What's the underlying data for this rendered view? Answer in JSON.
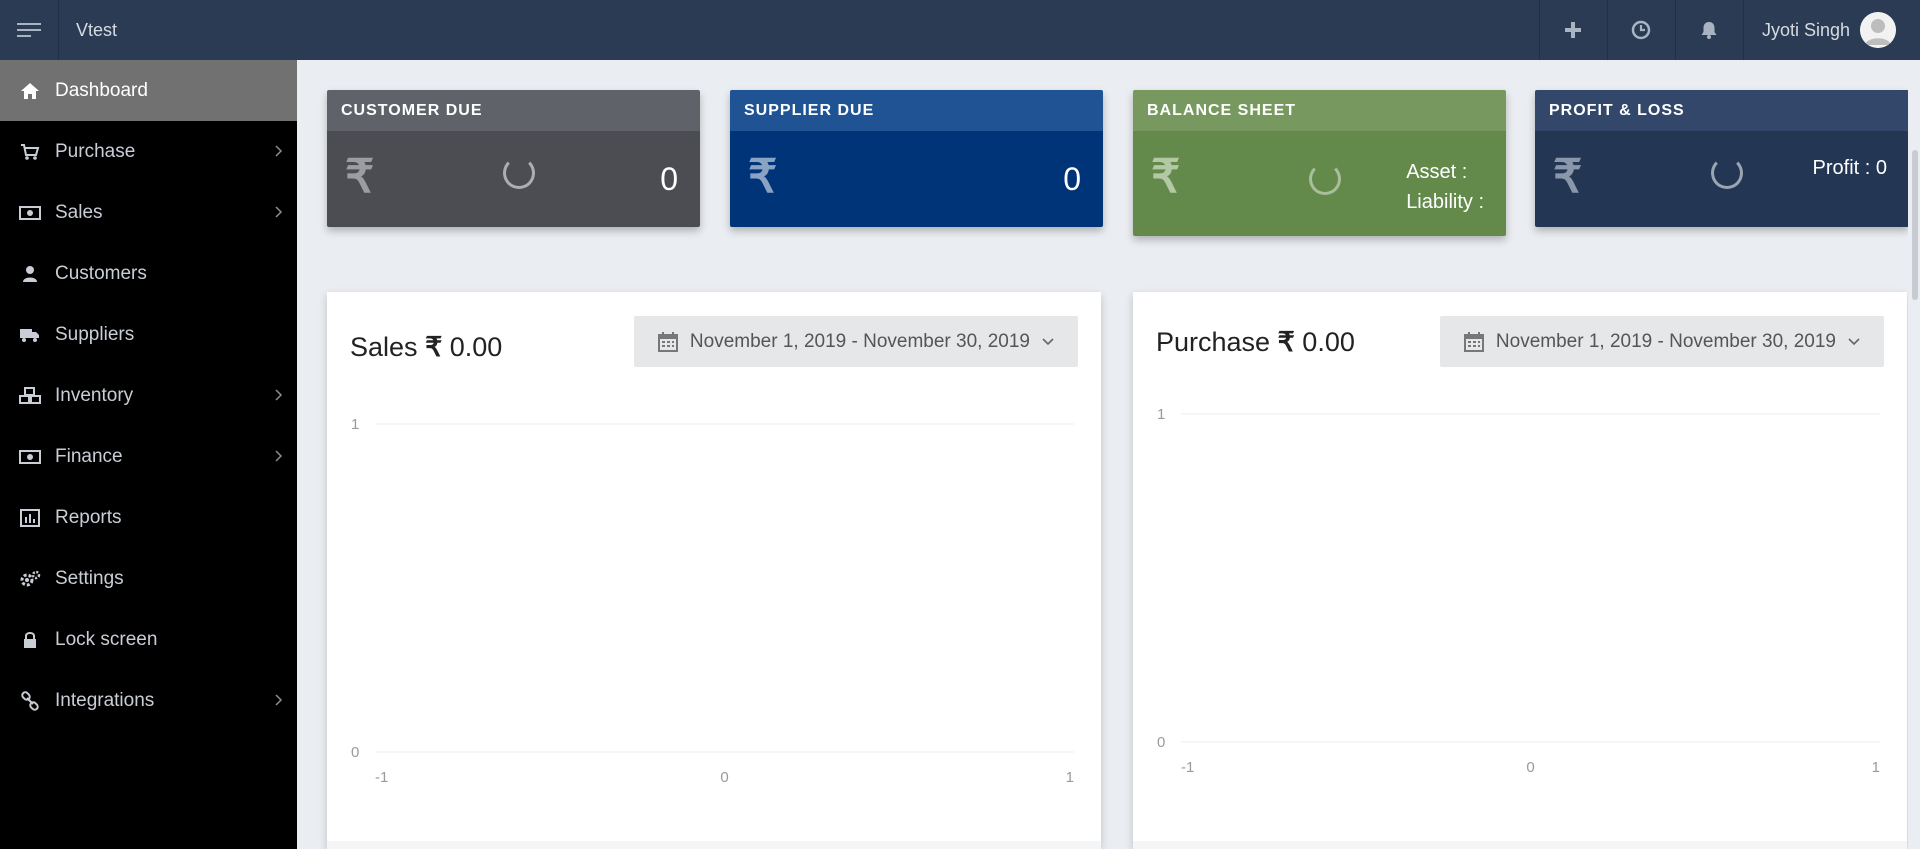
{
  "app": {
    "brand": "Vtest"
  },
  "topbar": {
    "add_icon": "plus-icon",
    "history_icon": "clock-icon",
    "notifications_icon": "bell-icon",
    "user_name": "Jyoti Singh"
  },
  "sidebar": {
    "items": [
      {
        "label": "Dashboard",
        "icon": "home-icon",
        "active": true,
        "has_submenu": false
      },
      {
        "label": "Purchase",
        "icon": "cart-icon",
        "active": false,
        "has_submenu": true
      },
      {
        "label": "Sales",
        "icon": "money-icon",
        "active": false,
        "has_submenu": true
      },
      {
        "label": "Customers",
        "icon": "user-icon",
        "active": false,
        "has_submenu": false
      },
      {
        "label": "Suppliers",
        "icon": "truck-icon",
        "active": false,
        "has_submenu": false
      },
      {
        "label": "Inventory",
        "icon": "cubes-icon",
        "active": false,
        "has_submenu": true
      },
      {
        "label": "Finance",
        "icon": "money-icon",
        "active": false,
        "has_submenu": true
      },
      {
        "label": "Reports",
        "icon": "bar-chart-icon",
        "active": false,
        "has_submenu": false
      },
      {
        "label": "Settings",
        "icon": "gears-icon",
        "active": false,
        "has_submenu": false
      },
      {
        "label": "Lock screen",
        "icon": "lock-icon",
        "active": false,
        "has_submenu": false
      },
      {
        "label": "Integrations",
        "icon": "link-icon",
        "active": false,
        "has_submenu": true
      }
    ]
  },
  "cards": {
    "customer_due": {
      "title": "CUSTOMER DUE",
      "currency": "₹",
      "value": "0"
    },
    "supplier_due": {
      "title": "SUPPLIER DUE",
      "currency": "₹",
      "value": "0"
    },
    "balance_sheet": {
      "title": "BALANCE SHEET",
      "currency": "₹",
      "asset_label": "Asset :",
      "liability_label": "Liability :"
    },
    "profit_loss": {
      "title": "PROFIT & LOSS",
      "currency": "₹",
      "profit_text": "Profit : 0"
    }
  },
  "panels": {
    "sales": {
      "title": "Sales",
      "currency": "₹",
      "amount": "0.00",
      "date_range": "November 1, 2019 - November 30, 2019"
    },
    "purchase": {
      "title": "Purchase",
      "currency": "₹",
      "amount": "0.00",
      "date_range": "November 1, 2019 - November 30, 2019"
    }
  },
  "colors": {
    "topbar": "#2a3b53",
    "sidebar": "#000000",
    "sidebar_active": "#717171",
    "customer_due_head": "#5f6269",
    "customer_due_body": "#4b4d52",
    "supplier_due_head": "#1f5394",
    "supplier_due_body": "#003478",
    "balance_sheet_head": "#77995f",
    "balance_sheet_body": "#638a4b",
    "profit_loss_head": "#33476a",
    "profit_loss_body": "#233754"
  },
  "chart_data": [
    {
      "type": "line",
      "title": "",
      "x": [],
      "series": [],
      "xlim": [
        -1,
        1
      ],
      "ylim": [
        0,
        1
      ],
      "x_ticks": [
        "-1",
        "0",
        "1"
      ],
      "y_ticks": [
        "0",
        "1"
      ],
      "grid": true
    },
    {
      "type": "line",
      "title": "",
      "x": [],
      "series": [],
      "xlim": [
        -1,
        1
      ],
      "ylim": [
        0,
        1
      ],
      "x_ticks": [
        "-1",
        "0",
        "1"
      ],
      "y_ticks": [
        "0",
        "1"
      ],
      "grid": true
    }
  ]
}
